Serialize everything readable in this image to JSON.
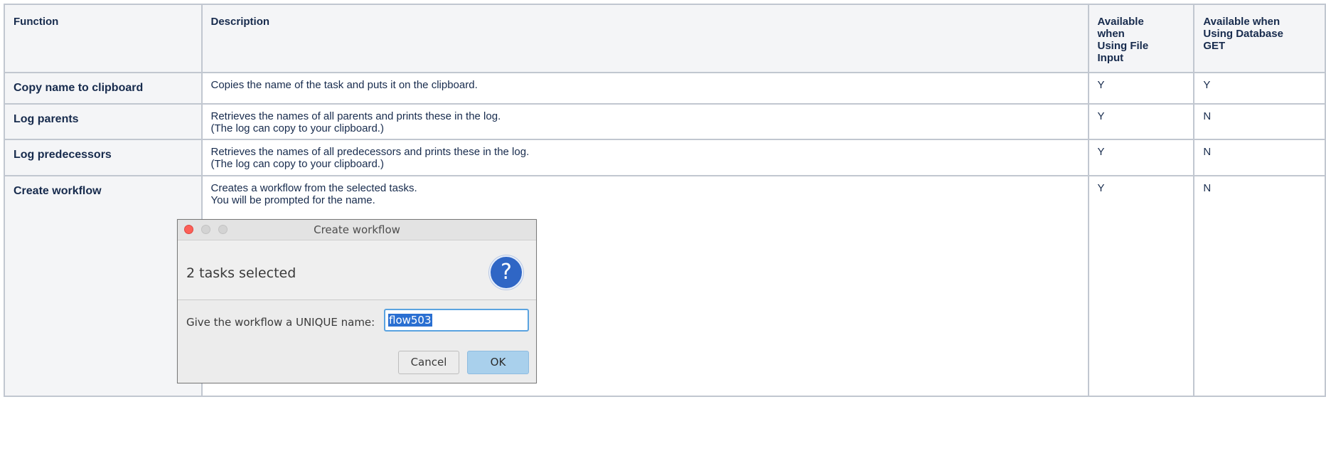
{
  "table": {
    "headers": {
      "function": "Function",
      "description": "Description",
      "file_input": [
        "Available",
        "when",
        "Using File",
        "Input"
      ],
      "database_get": [
        "Available when",
        "Using Database",
        "GET"
      ]
    },
    "rows": [
      {
        "function": "Copy name to clipboard",
        "description": [
          "Copies the name of the task and puts it on the clipboard."
        ],
        "file_input": "Y",
        "database_get": "Y"
      },
      {
        "function": "Log parents",
        "description": [
          "Retrieves the names of all parents and prints these in the log.",
          "(The log can copy to your clipboard.)"
        ],
        "file_input": "Y",
        "database_get": "N"
      },
      {
        "function": "Log predecessors",
        "description": [
          "Retrieves the names of all predecessors and prints these in the log.",
          "(The log can copy to your clipboard.)"
        ],
        "file_input": "Y",
        "database_get": "N"
      },
      {
        "function": "Create workflow",
        "description": [
          "Creates a workflow from the selected tasks.",
          "You will be prompted for the name."
        ],
        "file_input": "Y",
        "database_get": "N"
      }
    ]
  },
  "dialog": {
    "title": "Create workflow",
    "message": "2 tasks selected",
    "icon": "question-icon",
    "icon_glyph": "?",
    "prompt_label": "Give the workflow a UNIQUE name:",
    "input_value": "flow503",
    "cancel_label": "Cancel",
    "ok_label": "OK"
  },
  "colors": {
    "border": "#c1c7d0",
    "header_bg": "#f4f5f7",
    "close_button": "#fc5f57",
    "question_icon": "#2f66c5",
    "ok_button": "#a9d0ec",
    "selection": "#2a6fd1"
  }
}
